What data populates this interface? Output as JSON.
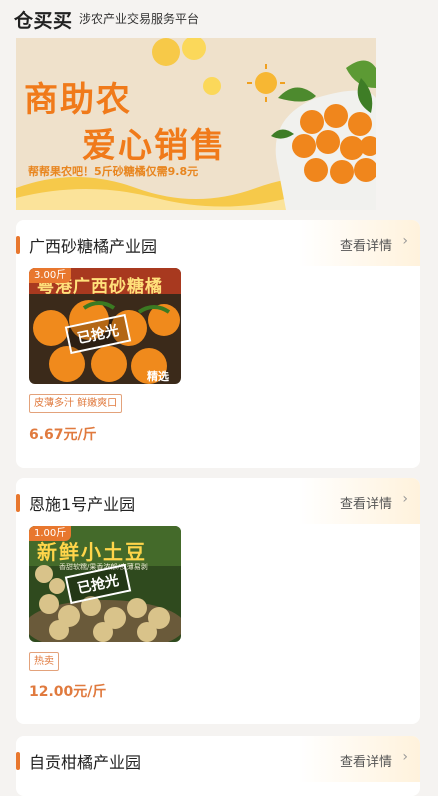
{
  "header": {
    "logo": "仓买买",
    "subtitle": "涉农产业交易服务平台"
  },
  "banner": {
    "title_line1": "商助农",
    "title_line2": "爱心销售",
    "caption": "帮帮果农吧！5斤砂糖橘仅需9.8元"
  },
  "cards": [
    {
      "title": "广西砂糖橘产业园",
      "detail_label": "查看详情",
      "weight": "3.00斤",
      "image_text": "粤港广西砂糖橘",
      "image_corner": "精选",
      "sold_label": "已抢光",
      "tags": [
        "皮薄多汁 鲜嫩爽口"
      ],
      "price": "6.67元/斤"
    },
    {
      "title": "恩施1号产业园",
      "detail_label": "查看详情",
      "weight": "1.00斤",
      "image_text": "新鲜小土豆",
      "image_subtext": "香甜软糯/果香浓郁/皮薄易剥",
      "sold_label": "已抢光",
      "tags": [
        "热卖"
      ],
      "price": "12.00元/斤"
    },
    {
      "title": "自贡柑橘产业园",
      "detail_label": "查看详情"
    }
  ]
}
